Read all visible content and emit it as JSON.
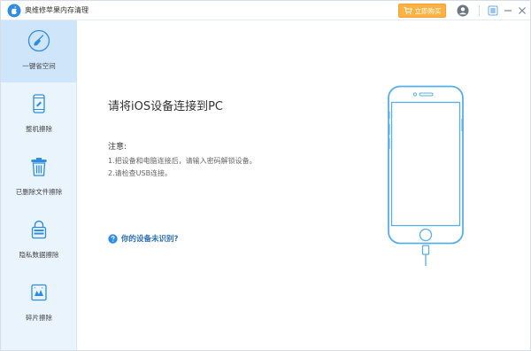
{
  "titlebar": {
    "app_title": "奥维修苹果内存清理",
    "buy_button": "立即购买"
  },
  "sidebar": {
    "items": [
      {
        "label": "一键省空间",
        "icon": "broom-icon",
        "active": true
      },
      {
        "label": "整机擦除",
        "icon": "phone-erase-icon",
        "active": false
      },
      {
        "label": "已删除文件擦除",
        "icon": "trash-icon",
        "active": false
      },
      {
        "label": "隐私数据擦除",
        "icon": "lock-icon",
        "active": false
      },
      {
        "label": "碎片擦除",
        "icon": "fragment-icon",
        "active": false
      }
    ]
  },
  "main": {
    "heading": "请将iOS设备连接到PC",
    "note_title": "注意:",
    "note_lines": [
      "1.把设备和电脑连接后，请输入密码解锁设备。",
      "2.请检查USB连接。"
    ],
    "help_link": "你的设备未识别?"
  },
  "colors": {
    "accent": "#2e8de0",
    "sidebar_bg": "#eaf4fd",
    "sidebar_active": "#cfe6fa",
    "buy_button": "#ffb23f",
    "phone_outline": "#5aaee8"
  }
}
